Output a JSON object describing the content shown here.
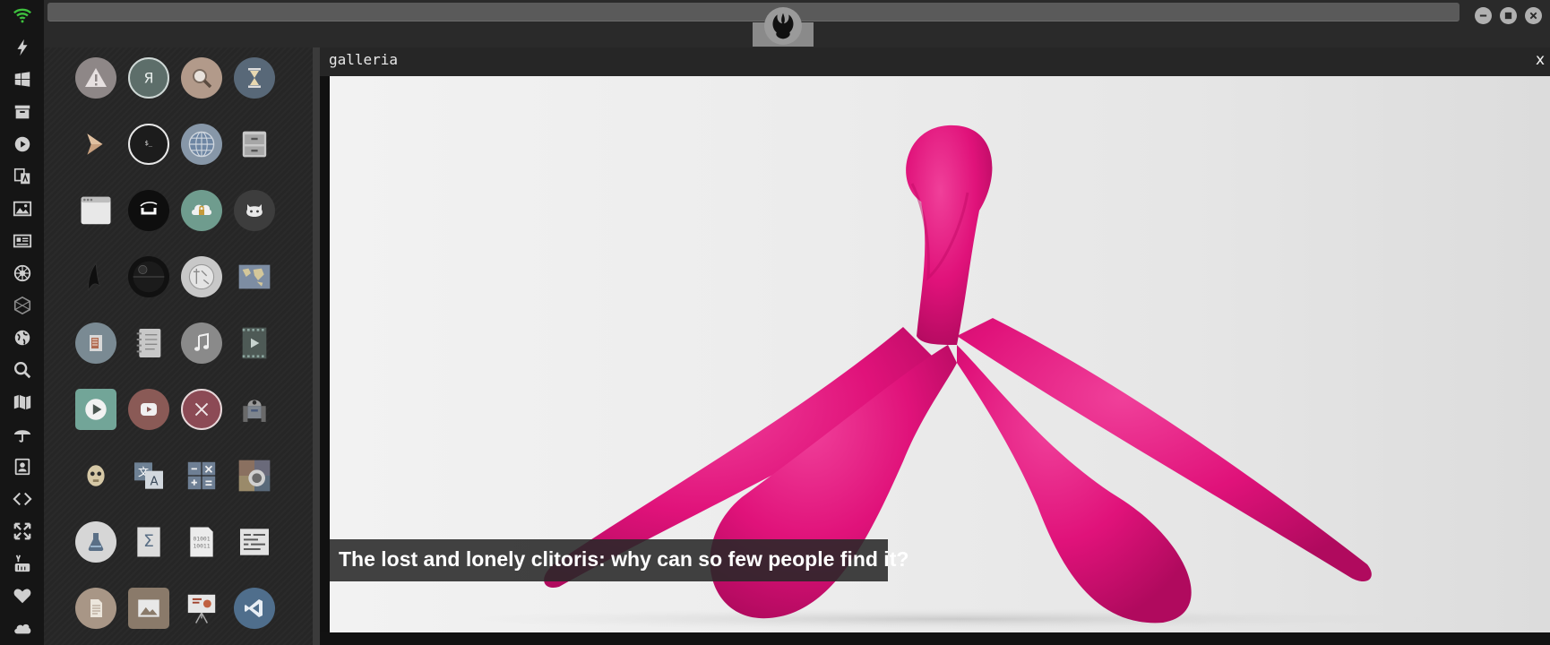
{
  "window": {
    "title": "galleria",
    "close_glyph": "x"
  },
  "gallery": {
    "caption": "The lost and lonely clitoris: why can so few people find it?"
  },
  "topbar": {
    "center_icon": "rebel-alliance-icon",
    "window_buttons": [
      "minimize-icon",
      "maximize-icon",
      "close-icon"
    ]
  },
  "dock": {
    "items": [
      "wifi-icon",
      "bolt-icon",
      "windows-icon",
      "archive-icon",
      "play-icon",
      "translate-icon",
      "image-icon",
      "news-icon",
      "empire-icon",
      "hexagon-icon",
      "globe-icon",
      "search-icon",
      "map-icon",
      "umbrella-icon",
      "contact-icon",
      "code-icon",
      "expand-icon",
      "youtube-icon",
      "heart-icon",
      "cloud-icon"
    ]
  },
  "launcher": {
    "apps": [
      "warning-app",
      "yandex-app",
      "search-app",
      "hourglass-app",
      "chevron-app",
      "terminal-app",
      "globe-app",
      "cabinet-app",
      "browser-window-app",
      "hammock-app",
      "cloud-lock-app",
      "github-app",
      "starfleet-app",
      "death-star-app",
      "wikipedia-app",
      "world-map-app",
      "files-app",
      "notebook-app",
      "music-app",
      "video-app",
      "video-player-app",
      "youtube-app",
      "close-app",
      "r2d2-app",
      "c3po-app",
      "translator-app",
      "calculator-app",
      "camera-app",
      "lab-flask-app",
      "sigma-app",
      "binary-app",
      "text-editor-app",
      "document-app",
      "image-viewer-app",
      "presentation-app",
      "vscode-app"
    ]
  },
  "colors": {
    "accent": "#e0127a",
    "wifi": "#3ec13e"
  }
}
